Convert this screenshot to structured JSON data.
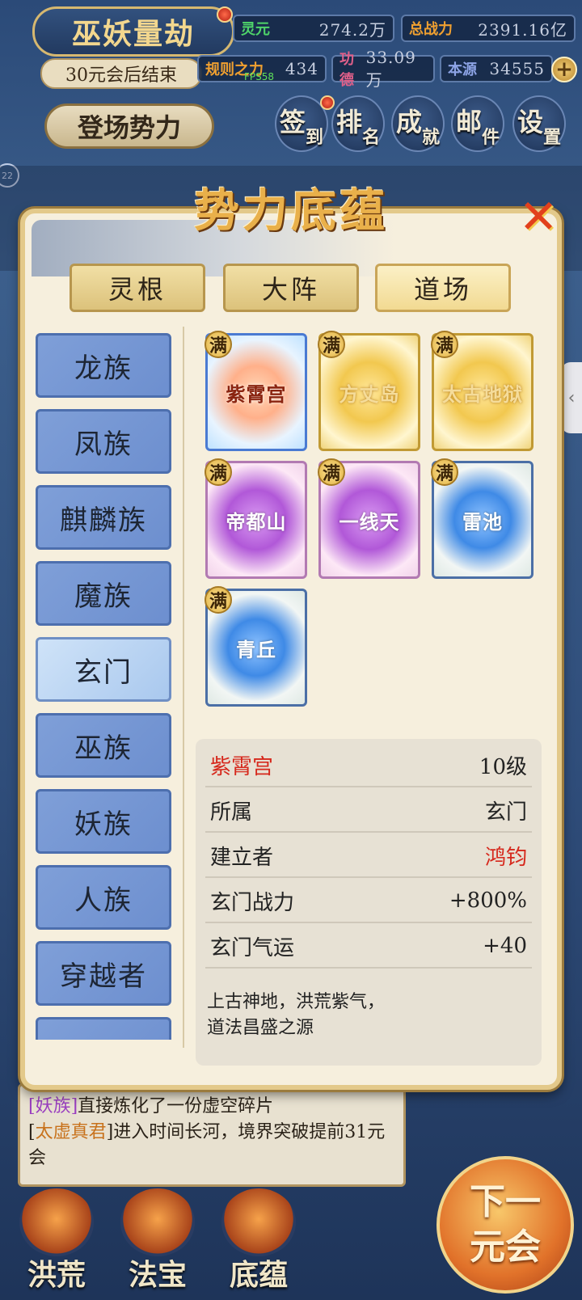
{
  "hud": {
    "title": "巫妖量劫",
    "countdown": "30元会后结束",
    "resources": [
      {
        "label": "灵元",
        "value": "274.2万",
        "color": "#4fd56a"
      },
      {
        "label": "总战力",
        "value": "2391.16亿",
        "color": "#f0a030"
      },
      {
        "label": "规则之力",
        "value": "434",
        "color": "#f0a030"
      },
      {
        "label": "功德",
        "value": "33.09万",
        "color": "#e0608a"
      },
      {
        "label": "本源",
        "value": "34555",
        "color": "#8da4e6"
      }
    ],
    "fps": "FPS58",
    "faction_button": "登场势力",
    "buttons": [
      {
        "main": "签",
        "sub": "到"
      },
      {
        "main": "排",
        "sub": "名"
      },
      {
        "main": "成",
        "sub": "就"
      },
      {
        "main": "邮",
        "sub": "件"
      },
      {
        "main": "设",
        "sub": "置"
      }
    ],
    "left_badge": "22"
  },
  "modal": {
    "title": "势力底蕴",
    "close_icon": "close-icon",
    "tabs": [
      "灵根",
      "大阵",
      "道场"
    ],
    "active_tab": 2,
    "sidebar": [
      "龙族",
      "凤族",
      "麒麟族",
      "魔族",
      "玄门",
      "巫族",
      "妖族",
      "人族",
      "穿越者"
    ],
    "active_sidebar": 4,
    "full_badge": "满",
    "cards": [
      {
        "name": "紫霄宫",
        "style": "red"
      },
      {
        "name": "方丈岛",
        "style": "gold"
      },
      {
        "name": "太古地狱",
        "style": "gold"
      },
      {
        "name": "帝都山",
        "style": "purple"
      },
      {
        "name": "一线天",
        "style": "purple"
      },
      {
        "name": "雷池",
        "style": "blue"
      },
      {
        "name": "青丘",
        "style": "blue"
      }
    ],
    "detail": {
      "name": "紫霄宫",
      "level": "10级",
      "rows": [
        {
          "label": "所属",
          "value": "玄门"
        },
        {
          "label": "建立者",
          "value": "鸿钧"
        },
        {
          "label": "玄门战力",
          "value": "+800%"
        },
        {
          "label": "玄门气运",
          "value": "+40"
        }
      ],
      "desc_line1": "上古神地，洪荒紫气，",
      "desc_line2": "道法昌盛之源"
    }
  },
  "log": {
    "line1_tag": "[妖族]",
    "line1_text": "直接炼化了一份虚空碎片",
    "line2_tag": "太虚真君",
    "line2_text": "]进入时间长河，境界突破提前31元会"
  },
  "next_button": {
    "line1": "下一",
    "line2": "元会"
  },
  "bottom_nav": [
    "洪荒",
    "法宝",
    "底蕴"
  ],
  "side_tab_icon": "chevron-left-icon"
}
